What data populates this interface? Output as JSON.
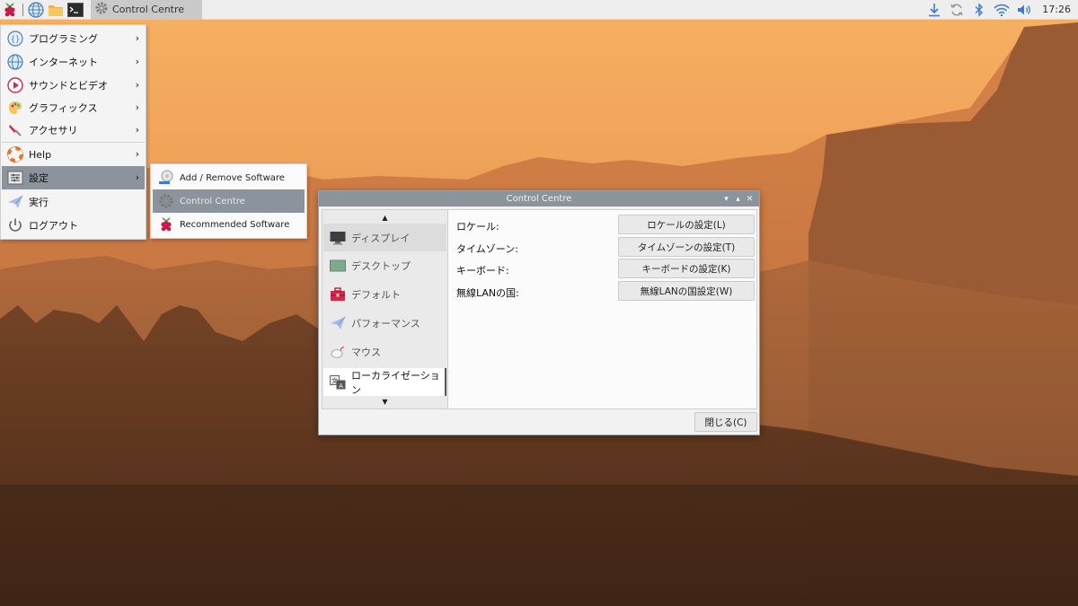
{
  "taskbar": {
    "task_title": "Control Centre",
    "clock": "17:26",
    "launchers": [
      "raspberry-icon",
      "globe-icon",
      "folder-icon",
      "terminal-icon"
    ],
    "tray_icons": [
      "download-icon",
      "sync-icon",
      "bluetooth-icon",
      "wifi-icon",
      "speaker-icon"
    ]
  },
  "main_menu": {
    "items": [
      {
        "label": "プログラミング",
        "icon": "programming-icon",
        "has_submenu": true
      },
      {
        "label": "インターネット",
        "icon": "globe-icon",
        "has_submenu": true
      },
      {
        "label": "サウンドとビデオ",
        "icon": "play-icon",
        "has_submenu": true
      },
      {
        "label": "グラフィックス",
        "icon": "palette-icon",
        "has_submenu": true
      },
      {
        "label": "アクセサリ",
        "icon": "knife-icon",
        "has_submenu": true
      },
      {
        "label": "Help",
        "icon": "lifebuoy-icon",
        "has_submenu": true
      },
      {
        "label": "設定",
        "icon": "settings-icon",
        "has_submenu": true
      },
      {
        "label": "実行",
        "icon": "paper-plane-icon",
        "has_submenu": false
      },
      {
        "label": "ログアウト",
        "icon": "power-icon",
        "has_submenu": false
      }
    ],
    "arrow": "›"
  },
  "sub_menu": {
    "items": [
      {
        "label": "Add / Remove Software",
        "icon": "package-icon"
      },
      {
        "label": "Control Centre",
        "icon": "gear-icon"
      },
      {
        "label": "Recommended Software",
        "icon": "raspberry-icon"
      }
    ]
  },
  "window": {
    "title": "Control Centre",
    "controls": {
      "minimize": "▾",
      "maximize": "▴",
      "close": "✕"
    },
    "scroll_up": "▲",
    "scroll_down": "▼",
    "sidebar": [
      {
        "label": "ディスプレイ",
        "icon": "monitor-icon"
      },
      {
        "label": "デスクトップ",
        "icon": "desktop-icon"
      },
      {
        "label": "デフォルト",
        "icon": "toolbox-icon"
      },
      {
        "label": "パフォーマンス",
        "icon": "paper-plane-icon"
      },
      {
        "label": "マウス",
        "icon": "mouse-icon"
      },
      {
        "label": "ローカライゼーション",
        "icon": "translate-icon"
      }
    ],
    "settings": [
      {
        "label": "ロケール:",
        "button": "ロケールの設定(L)"
      },
      {
        "label": "タイムゾーン:",
        "button": "タイムゾーンの設定(T)"
      },
      {
        "label": "キーボード:",
        "button": "キーボードの設定(K)"
      },
      {
        "label": "無線LANの国:",
        "button": "無線LANの国設定(W)"
      }
    ],
    "close_button": "閉じる(C)"
  }
}
